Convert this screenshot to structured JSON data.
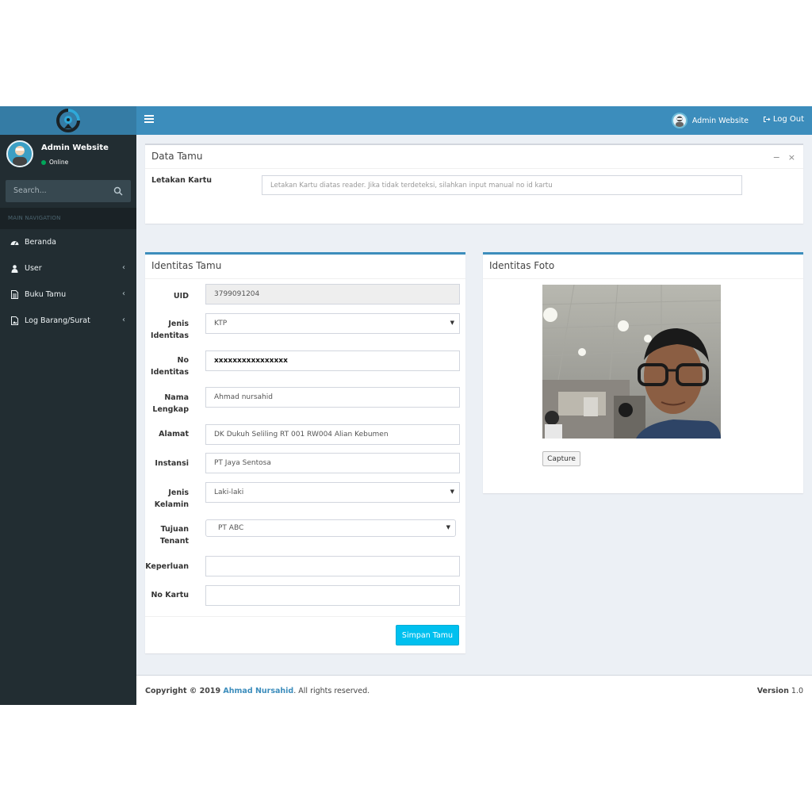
{
  "header": {
    "user_name": "Admin Website",
    "logout_label": "Log Out"
  },
  "sidebar": {
    "user_name": "Admin Website",
    "status": "Online",
    "search_placeholder": "Search...",
    "nav_header": "MAIN NAVIGATION",
    "items": [
      {
        "label": "Beranda"
      },
      {
        "label": "User"
      },
      {
        "label": "Buku Tamu"
      },
      {
        "label": "Log Barang/Surat"
      }
    ]
  },
  "data_tamu": {
    "title": "Data Tamu",
    "card_label": "Letakan Kartu",
    "card_placeholder": "Letakan Kartu diatas reader. Jika tidak terdeteksi, silahkan input manual no id kartu"
  },
  "identitas_tamu": {
    "title": "Identitas Tamu",
    "fields": {
      "uid": {
        "label": "UID",
        "value": "3799091204"
      },
      "jenis_identitas": {
        "label_1": "Jenis",
        "label_2": "Identitas",
        "value": "KTP"
      },
      "no_identitas": {
        "label_1": "No",
        "label_2": "Identitas",
        "value": "xxxxxxxxxxxxxxxx"
      },
      "nama": {
        "label_1": "Nama",
        "label_2": "Lengkap",
        "value": "Ahmad nursahid"
      },
      "alamat": {
        "label": "Alamat",
        "value": "DK Dukuh Seliling RT 001 RW004 Alian Kebumen"
      },
      "instansi": {
        "label": "Instansi",
        "value": "PT Jaya Sentosa"
      },
      "jenis_kelamin": {
        "label_1": "Jenis",
        "label_2": "Kelamin",
        "value": "Laki-laki"
      },
      "tujuan": {
        "label_1": "Tujuan",
        "label_2": "Tenant",
        "value": "PT ABC"
      },
      "keperluan": {
        "label": "Keperluan",
        "value": ""
      },
      "no_kartu": {
        "label": "No Kartu",
        "value": ""
      }
    },
    "submit_label": "Simpan Tamu"
  },
  "identitas_foto": {
    "title": "Identitas Foto",
    "capture_label": "Capture"
  },
  "footer": {
    "copyright_prefix": "Copyright © 2019 ",
    "author": "Ahmad Nursahid",
    "rights": ". All rights reserved.",
    "version_label": "Version",
    "version": " 1.0"
  },
  "colors": {
    "header": "#3c8dbc",
    "logo_bg": "#357ca5",
    "sidebar": "#222d32",
    "content_bg": "#ecf0f5",
    "button_info": "#00c0ef",
    "status_online": "#00a65a"
  }
}
